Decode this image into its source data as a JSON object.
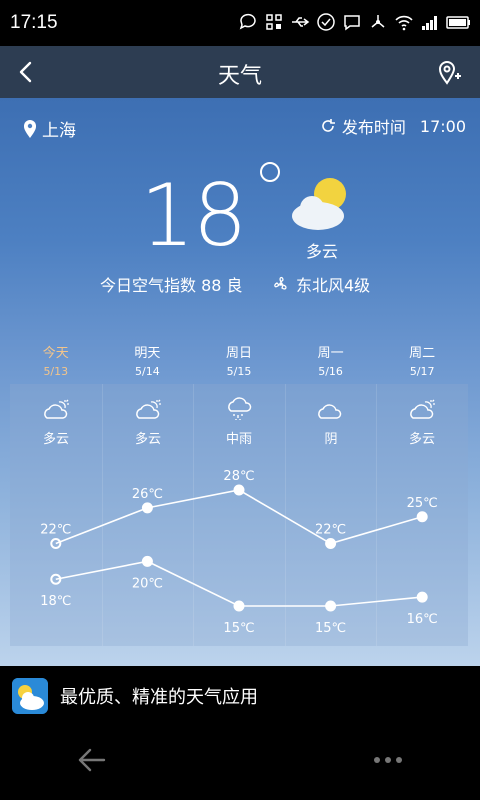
{
  "status": {
    "time": "17:15"
  },
  "header": {
    "title": "天气"
  },
  "location": {
    "city": "上海"
  },
  "publish": {
    "label": "发布时间",
    "time": "17:00"
  },
  "current": {
    "temperature": "18",
    "condition": "多云",
    "aqi_text": "今日空气指数  88 良",
    "wind": "东北风4级"
  },
  "forecast": [
    {
      "day": "今天",
      "date": "5/13",
      "condition": "多云",
      "icon": "partly-cloudy-icon",
      "high": 22,
      "low": 18,
      "high_label": "22℃",
      "low_label": "18℃"
    },
    {
      "day": "明天",
      "date": "5/14",
      "condition": "多云",
      "icon": "partly-cloudy-icon",
      "high": 26,
      "low": 20,
      "high_label": "26℃",
      "low_label": "20℃"
    },
    {
      "day": "周日",
      "date": "5/15",
      "condition": "中雨",
      "icon": "rain-icon",
      "high": 28,
      "low": 15,
      "high_label": "28℃",
      "low_label": "15℃"
    },
    {
      "day": "周一",
      "date": "5/16",
      "condition": "阴",
      "icon": "cloud-icon",
      "high": 22,
      "low": 15,
      "high_label": "22℃",
      "low_label": "15℃"
    },
    {
      "day": "周二",
      "date": "5/17",
      "condition": "多云",
      "icon": "partly-cloudy-icon",
      "high": 25,
      "low": 16,
      "high_label": "25℃",
      "low_label": "16℃"
    }
  ],
  "chart_data": {
    "type": "line",
    "categories": [
      "今天",
      "明天",
      "周日",
      "周一",
      "周二"
    ],
    "series": [
      {
        "values": [
          22,
          26,
          28,
          22,
          25
        ]
      },
      {
        "values": [
          18,
          20,
          15,
          15,
          16
        ]
      }
    ],
    "unit": "℃"
  },
  "banner": {
    "text": "最优质、精准的天气应用"
  },
  "colors": {
    "today": "#f3c58b",
    "appbar": "#2d3d52",
    "sky_top": "#3d6fb3",
    "sky_bottom": "#bcd3ec"
  }
}
